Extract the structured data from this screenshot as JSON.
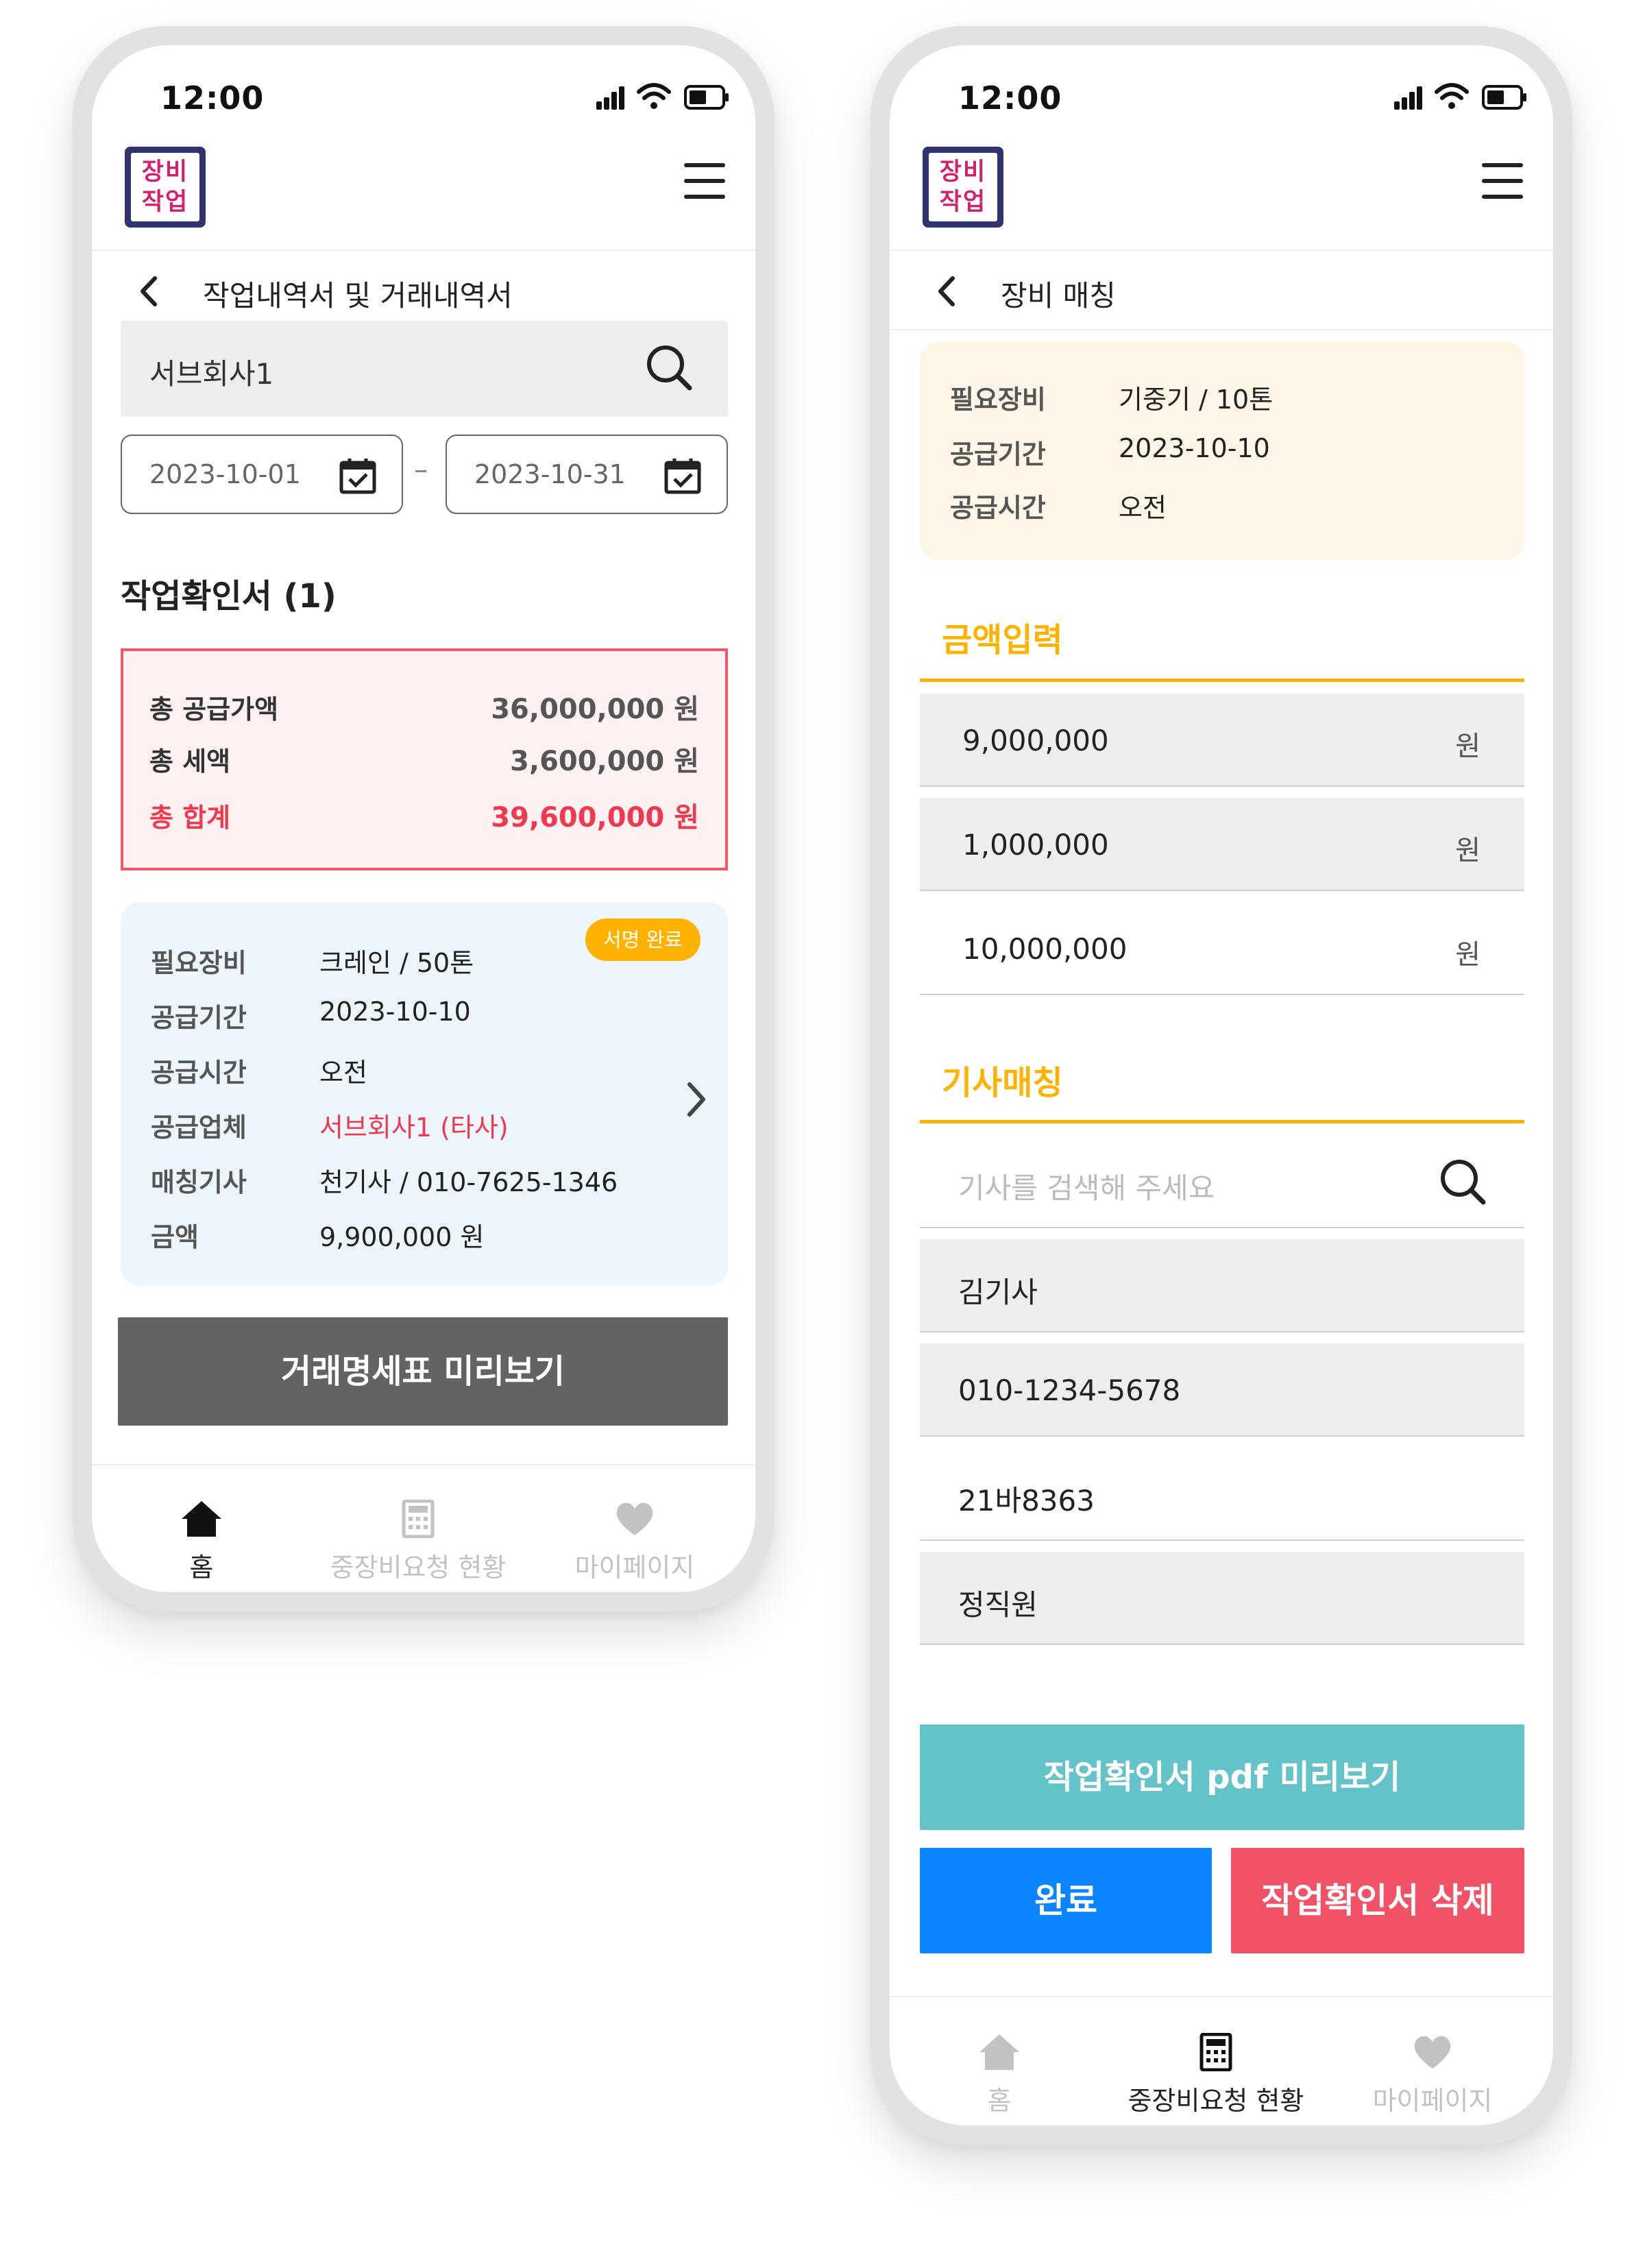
{
  "status_bar": {
    "time": "12:00"
  },
  "app": {
    "logo_text_line1": "장비",
    "logo_text_line2": "작업"
  },
  "left_screen": {
    "page_title": "작업내역서 및 거래내역서",
    "search_value": "서브회사1",
    "date_from": "2023-10-01",
    "date_to": "2023-10-31",
    "section_title": "작업확인서 (1)",
    "summary": {
      "supply_label": "총 공급가액",
      "supply_value": "36,000,000 원",
      "tax_label": "총 세액",
      "tax_value": "3,600,000 원",
      "total_label": "총 합계",
      "total_value": "39,600,000 원"
    },
    "card": {
      "badge": "서명 완료",
      "rows": [
        {
          "label": "필요장비",
          "value": "크레인 / 50톤"
        },
        {
          "label": "공급기간",
          "value": "2023-10-10"
        },
        {
          "label": "공급시간",
          "value": "오전"
        },
        {
          "label": "공급업체",
          "value": "서브회사1 (타사)"
        },
        {
          "label": "매칭기사",
          "value": "천기사 / 010-7625-1346"
        },
        {
          "label": "금액",
          "value": "9,900,000 원"
        }
      ]
    },
    "preview_button": "거래명세표 미리보기",
    "tabs": [
      {
        "label": "홈",
        "icon": "home-icon",
        "active": true
      },
      {
        "label": "중장비요청 현황",
        "icon": "calculator-icon",
        "active": false
      },
      {
        "label": "마이페이지",
        "icon": "heart-icon",
        "active": false
      }
    ]
  },
  "right_screen": {
    "page_title": "장비 매칭",
    "info": [
      {
        "label": "필요장비",
        "value": "기중기 / 10톤"
      },
      {
        "label": "공급기간",
        "value": "2023-10-10"
      },
      {
        "label": "공급시간",
        "value": "오전"
      }
    ],
    "amount_title": "금액입력",
    "amounts": [
      {
        "value": "9,000,000",
        "unit": "원"
      },
      {
        "value": "1,000,000",
        "unit": "원"
      },
      {
        "value": "10,000,000",
        "unit": "원"
      }
    ],
    "driver_title": "기사매칭",
    "driver_search_placeholder": "기사를 검색해 주세요",
    "driver_rows": [
      "김기사",
      "010-1234-5678",
      "21바8363",
      "정직원"
    ],
    "pdf_button": "작업확인서 pdf 미리보기",
    "done_button": "완료",
    "delete_button": "작업확인서 삭제",
    "tabs": [
      {
        "label": "홈",
        "icon": "home-icon",
        "active": false
      },
      {
        "label": "중장비요청 현황",
        "icon": "calculator-icon",
        "active": true
      },
      {
        "label": "마이페이지",
        "icon": "heart-icon",
        "active": false
      }
    ]
  },
  "colors": {
    "accent_orange": "#ffb300",
    "alert_red": "#f0384e",
    "brand_navy": "#2f3470",
    "brand_magenta": "#d41f6f",
    "teal": "#63c3c8",
    "blue": "#0a84ff"
  }
}
